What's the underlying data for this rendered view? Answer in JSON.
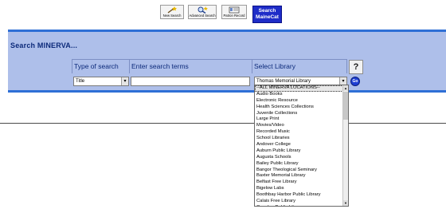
{
  "toolbar": {
    "new_search": "New Search",
    "advanced_search": "Advanced Search",
    "patron_record": "Patron Record",
    "maine_cat": "Search MaineCat"
  },
  "search": {
    "title": "Search MINERVA...",
    "col_type": "Type of search",
    "col_terms": "Enter search terms",
    "col_library": "Select Library",
    "help": "?",
    "type_value": "Title",
    "terms_value": "",
    "library_value": "Thomas Memorial Library",
    "go": "Go"
  },
  "library_options": [
    "--ALL MINERVA LOCATIONS--",
    "Audio Books",
    "Electronic Resource",
    "Health Sciences Collections",
    "Juvenile Collections",
    "Large Print",
    "Movies/Video",
    "Recorded Music",
    "School Libraries",
    "Andover College",
    "Auburn Public Library",
    "Augusta Schools",
    "Bailey Public Library",
    "Bangor Theological Seminary",
    "Baxter Memorial Library",
    "Belfast Free Library",
    "Bigelow Labs",
    "Boothbay Harbor Public Library",
    "Calais Free Library",
    "Camden Public Library"
  ],
  "colors": {
    "band": "#aebfea",
    "band_border": "#2f6fd6",
    "maine_button": "#1e2cc8"
  }
}
